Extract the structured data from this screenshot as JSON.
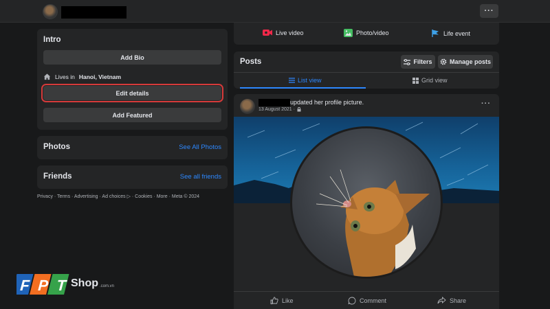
{
  "intro": {
    "title": "Intro",
    "add_bio": "Add Bio",
    "lives_prefix": "Lives in",
    "lives_city": "Hanoi, Vietnam",
    "edit_details": "Edit details",
    "add_featured": "Add Featured"
  },
  "photos": {
    "title": "Photos",
    "link": "See All Photos"
  },
  "friends": {
    "title": "Friends",
    "link": "See all friends"
  },
  "footer": "Privacy · Terms · Advertising · Ad choices ▷ · Cookies · More · Meta © 2024",
  "actions": {
    "live": "Live video",
    "photo": "Photo/video",
    "life": "Life event"
  },
  "posts": {
    "title": "Posts",
    "filters": "Filters",
    "manage": "Manage posts",
    "list_view": "List view",
    "grid_view": "Grid view"
  },
  "post": {
    "headline": "updated her profile picture.",
    "date": "13 August 2021 ·"
  },
  "reactions": {
    "like": "Like",
    "comment": "Comment",
    "share": "Share"
  },
  "watermark": {
    "brand": "FPT",
    "shop": "Shop",
    "domain": ".com.vn"
  },
  "colors": {
    "accent": "#2d88ff",
    "highlight_border": "#d63a3a",
    "background": "#18191a",
    "card": "#242526"
  }
}
